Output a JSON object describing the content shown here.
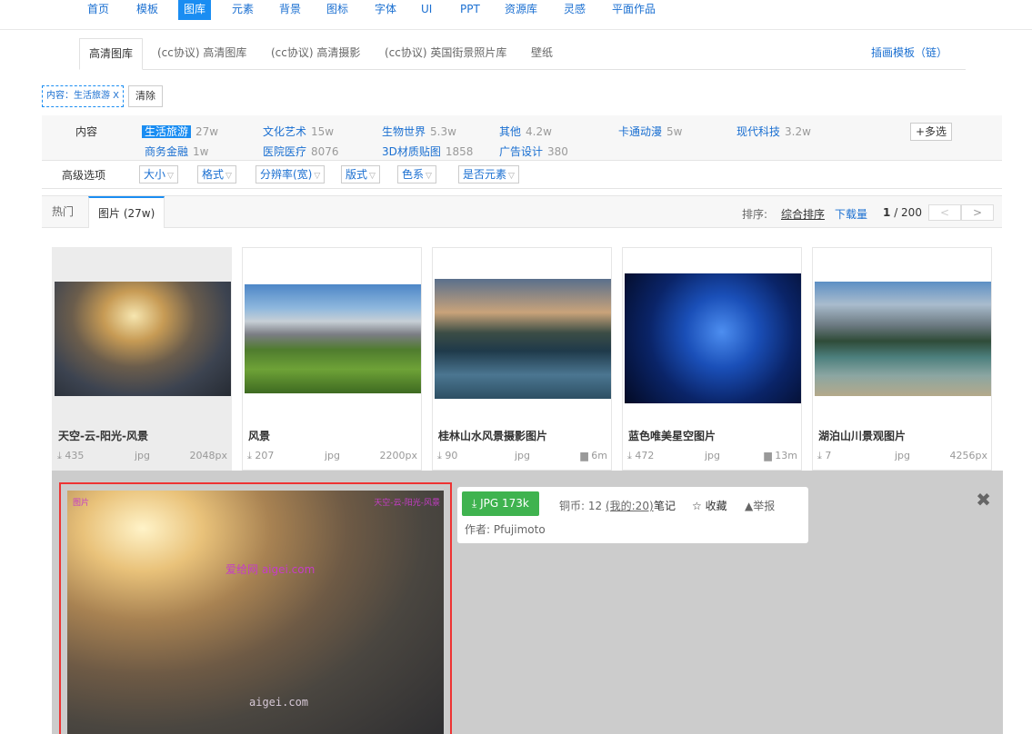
{
  "topnav": [
    "首页",
    "模板",
    "图库",
    "元素",
    "背景",
    "图标",
    "字体",
    "UI",
    "PPT",
    "资源库",
    "灵感",
    "平面作品"
  ],
  "subtabs": [
    "高清图库",
    "(cc协议) 高清图库",
    "(cc协议) 高清摄影",
    "(cc协议) 英国街景照片库",
    "壁纸"
  ],
  "subtab_right": "插画模板（链）",
  "filter_chip": "内容：生活旅游 X",
  "clear_label": "清除",
  "content_label": "内容",
  "categories": [
    {
      "name": "生活旅游",
      "count": "27w"
    },
    {
      "name": "文化艺术",
      "count": "15w"
    },
    {
      "name": "生物世界",
      "count": "5.3w"
    },
    {
      "name": "其他",
      "count": "4.2w"
    },
    {
      "name": "卡通动漫",
      "count": "5w"
    },
    {
      "name": "现代科技",
      "count": "3.2w"
    },
    {
      "name": "商务金融",
      "count": "1w"
    },
    {
      "name": "医院医疗",
      "count": "8076"
    },
    {
      "name": "3D材质贴图",
      "count": "1858"
    },
    {
      "name": "广告设计",
      "count": "380"
    }
  ],
  "multi_label": "+多选",
  "advanced_label": "高级选项",
  "advanced_options": [
    "大小",
    "格式",
    "分辨率(宽)",
    "版式",
    "色系",
    "是否元素"
  ],
  "result_tabs": [
    "热门",
    "图片 (27w)"
  ],
  "sort_label": "排序:",
  "sort_options": [
    "综合排序",
    "下载量"
  ],
  "page_current": "1",
  "page_total": "/ 200",
  "pager_prev": "<",
  "pager_next": ">",
  "cards": [
    {
      "title": "天空-云-阳光-风景",
      "downloads": "435",
      "format": "jpg",
      "size": "2048px",
      "icon": "download-icon"
    },
    {
      "title": "风景",
      "downloads": "207",
      "format": "jpg",
      "size": "2200px",
      "icon": "download-icon"
    },
    {
      "title": "桂林山水风景摄影图片",
      "downloads": "90",
      "format": "jpg",
      "size": "6m",
      "icon": "download-icon"
    },
    {
      "title": "蓝色唯美星空图片",
      "downloads": "472",
      "format": "jpg",
      "size": "13m",
      "icon": "download-icon"
    },
    {
      "title": "湖泊山川景观图片",
      "downloads": "7",
      "format": "jpg",
      "size": "4256px",
      "icon": "download-icon"
    }
  ],
  "detail": {
    "download_label": "JPG  173k",
    "coins_text": "铜币: 12 ",
    "coins_link": "(我的:20)",
    "notes_label": "笔记",
    "favorite_label": "收藏",
    "report_label": "举报",
    "author": "作者: Pfujimoto",
    "watermark_tl": "图片",
    "watermark_tr": "天空-云-阳光-风景",
    "watermark_center": "爱给网 aigei.com",
    "watermark_bottom": "aigei.com"
  },
  "colors": {
    "accent": "#1a8df2",
    "link": "#1a6fd1",
    "download_green": "#3fb34f",
    "highlight_border": "#e33333"
  }
}
